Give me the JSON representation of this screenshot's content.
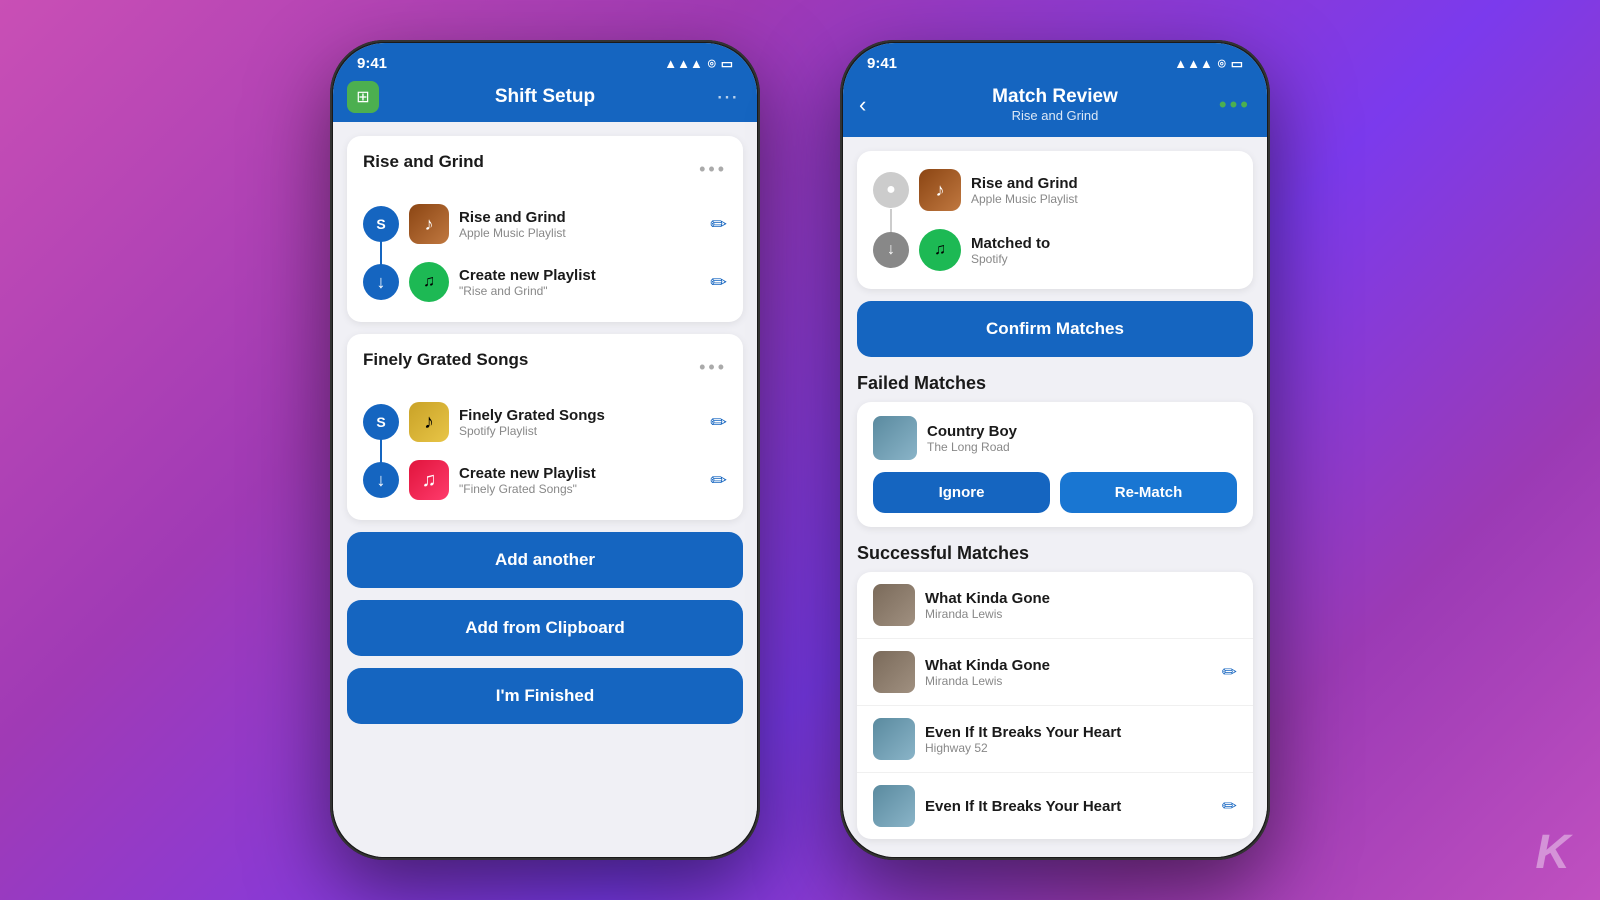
{
  "background": {
    "gradient": "linear-gradient(135deg, #c94fb5 0%, #a03ab5 30%, #7b3aed 60%, #9b3ab5 80%, #c050c0 100%)"
  },
  "phone1": {
    "status_bar": {
      "time": "9:41",
      "signal": "▲▲▲",
      "wifi": "wifi",
      "battery": "battery"
    },
    "header": {
      "title": "Shift Setup",
      "icon": "☰"
    },
    "section1": {
      "title": "Rise and Grind",
      "source": {
        "name": "Rise and Grind",
        "type": "Apple Music Playlist"
      },
      "destination": {
        "name": "Create new Playlist",
        "sub": "\"Rise and Grind\""
      }
    },
    "section2": {
      "title": "Finely Grated Songs",
      "source": {
        "name": "Finely Grated Songs",
        "type": "Spotify Playlist"
      },
      "destination": {
        "name": "Create new Playlist",
        "sub": "\"Finely Grated Songs\""
      }
    },
    "buttons": {
      "add_another": "Add another",
      "add_clipboard": "Add from Clipboard",
      "im_finished": "I'm Finished"
    }
  },
  "phone2": {
    "status_bar": {
      "time": "9:41"
    },
    "header": {
      "title": "Match Review",
      "subtitle": "Rise and Grind",
      "back": "‹",
      "dots": "●●●"
    },
    "transfer": {
      "source": {
        "name": "Rise and Grind",
        "type": "Apple Music Playlist"
      },
      "destination": {
        "name": "Matched to",
        "type": "Spotify"
      }
    },
    "confirm_btn": "Confirm Matches",
    "failed_section": {
      "title": "Failed Matches",
      "song": {
        "name": "Country Boy",
        "album": "The Long Road"
      },
      "ignore_btn": "Ignore",
      "rematch_btn": "Re-Match"
    },
    "successful_section": {
      "title": "Successful Matches",
      "songs": [
        {
          "name": "What Kinda Gone",
          "artist": "Miranda Lewis",
          "has_edit": false
        },
        {
          "name": "What Kinda Gone",
          "artist": "Miranda Lewis",
          "has_edit": true
        },
        {
          "name": "Even If It Breaks Your Heart",
          "artist": "Highway 52",
          "has_edit": false
        },
        {
          "name": "Even If It Breaks Your Heart",
          "artist": "",
          "has_edit": true
        }
      ]
    }
  },
  "watermark": "K"
}
